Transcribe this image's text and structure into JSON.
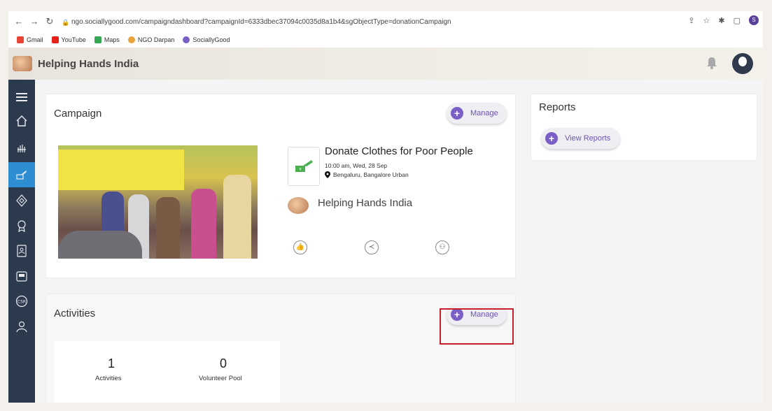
{
  "browser": {
    "url": "ngo.sociallygood.com/campaigndashboard?campaignId=6333dbec37094c0035d8a1b4&sgObjectType=donationCampaign",
    "bookmarks": [
      "Gmail",
      "YouTube",
      "Maps",
      "NGO Darpan",
      "SociallyGood"
    ],
    "profile_initial": "S"
  },
  "header": {
    "title": "Helping Hands India"
  },
  "campaign": {
    "title": "Campaign",
    "manage_label": "Manage",
    "event_title": "Donate Clothes for Poor People",
    "event_time": "10:00 am, Wed, 28 Sep",
    "event_location": "Bengaluru, Bangalore Urban",
    "org_name": "Helping Hands India"
  },
  "reports": {
    "title": "Reports",
    "button_label": "View Reports"
  },
  "activities": {
    "title": "Activities",
    "manage_label": "Manage",
    "stats": [
      {
        "value": "1",
        "label": "Activities"
      },
      {
        "value": "0",
        "label": "Volunteer Pool"
      }
    ]
  },
  "colors": {
    "sidebar": "#2c3a4d",
    "sidebar_active": "#2d8ed1",
    "accent_purple": "#7a5fc7",
    "highlight_red": "#c6202d"
  }
}
